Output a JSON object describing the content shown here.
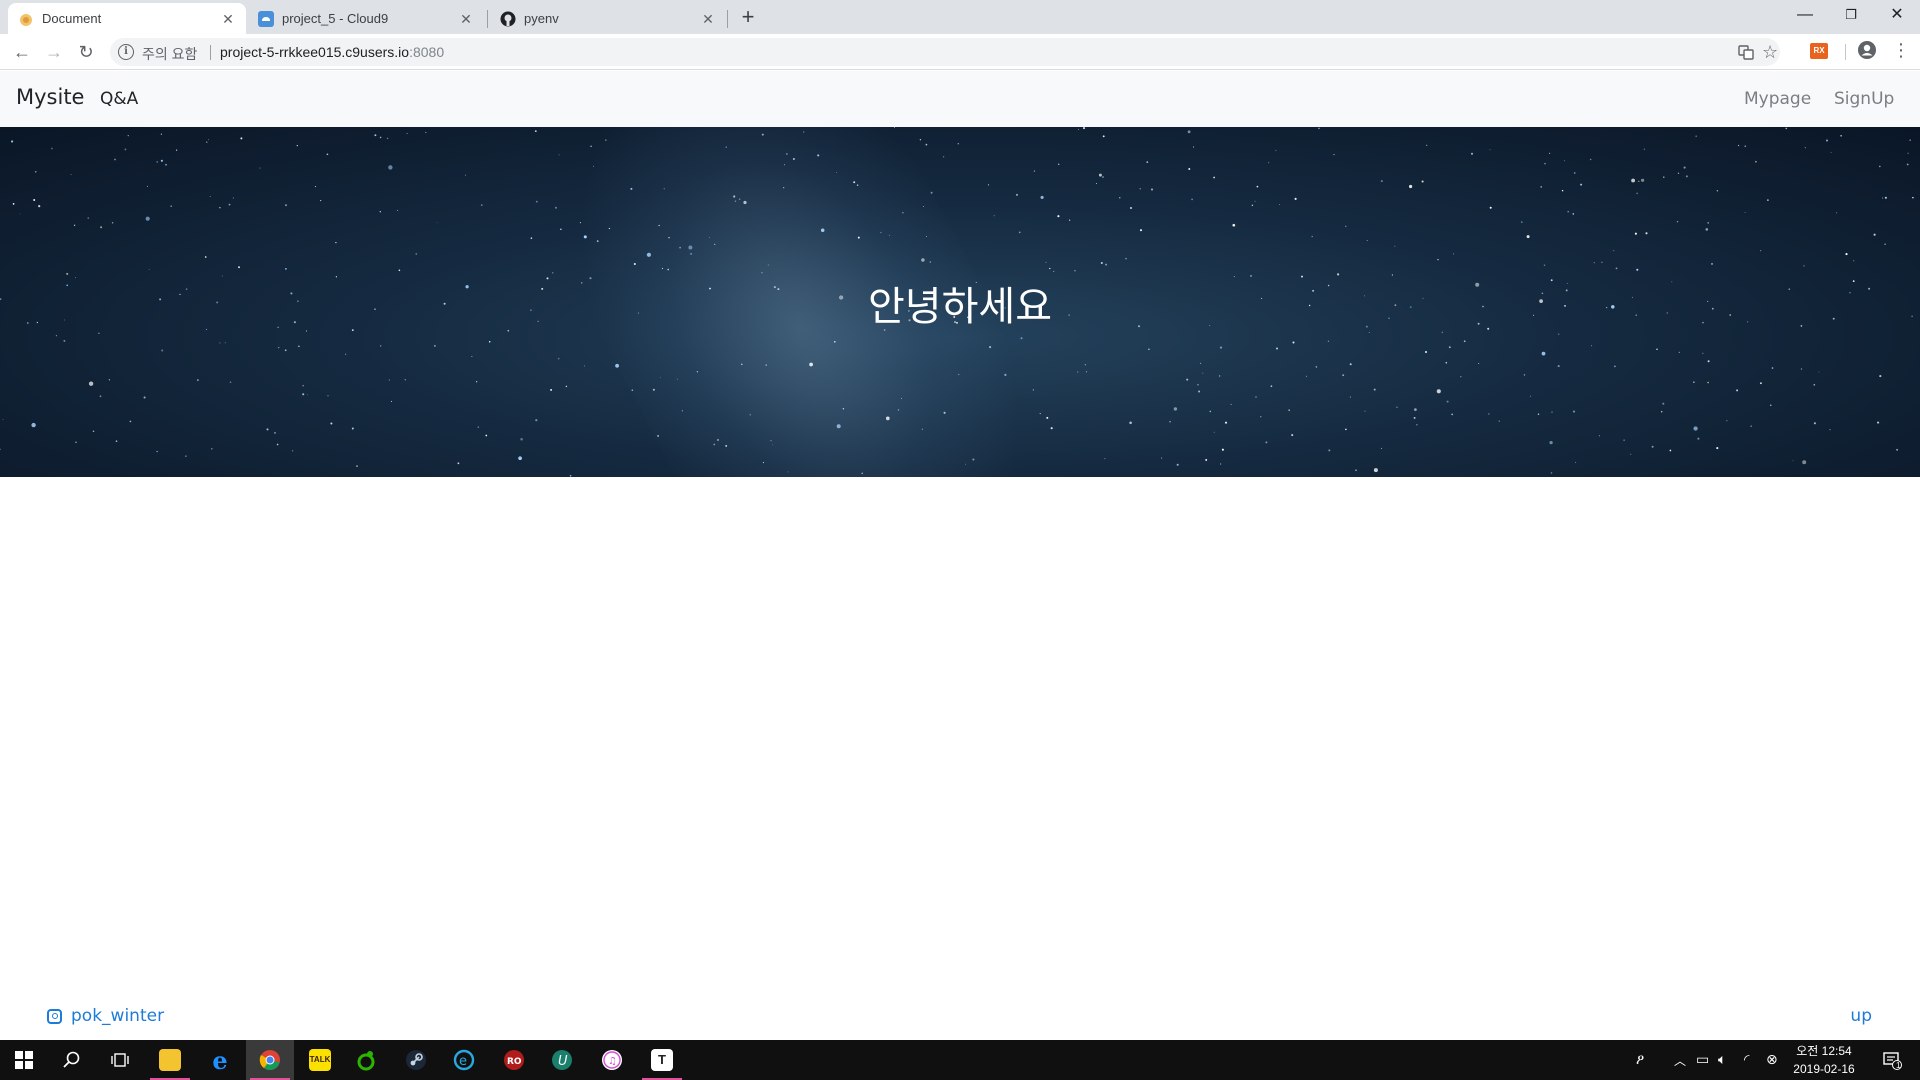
{
  "browser": {
    "tabs": [
      {
        "title": "Document",
        "active": true
      },
      {
        "title": "project_5 - Cloud9",
        "active": false
      },
      {
        "title": "pyenv",
        "active": false
      }
    ],
    "new_tab_icon": "plus-icon",
    "window_controls": [
      "minimize-icon",
      "restore-icon",
      "close-icon"
    ],
    "address": {
      "security_label": "주의 요함",
      "url_host": "project-5-rrkkee015.c9users.io",
      "url_port": ":8080"
    },
    "extension_badge": "RX"
  },
  "site": {
    "brand": "Mysite",
    "nav_left": [
      "Q&A"
    ],
    "nav_right": [
      "Mypage",
      "SignUp"
    ],
    "hero_title": "안녕하세요",
    "footer": {
      "instagram_handle": "pok_winter",
      "up_link": "up"
    }
  },
  "taskbar": {
    "apps": [
      "start-icon",
      "search-icon",
      "task-view-icon",
      "file-explorer-icon",
      "edge-icon",
      "chrome-icon",
      "kakaotalk-icon",
      "naver-line-icon",
      "steam-icon",
      "ie-icon",
      "game-icon",
      "u-app-icon",
      "itunes-icon",
      "typora-icon"
    ],
    "clock": {
      "time": "오전 12:54",
      "date": "2019-02-16"
    },
    "notification_count": "1"
  }
}
